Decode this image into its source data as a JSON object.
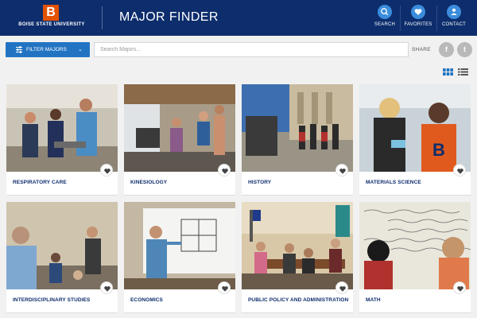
{
  "header": {
    "logo_letter": "B",
    "logo_text": "BOISE STATE UNIVERSITY",
    "title": "MAJOR FINDER",
    "search_label": "SEARCH",
    "favorites_label": "FAVORITES",
    "contact_label": "CONTACT"
  },
  "toolbar": {
    "filter_label": "FILTER MAJORS",
    "search_placeholder": "Search Majors...",
    "share_label": "SHARE",
    "facebook_glyph": "f",
    "twitter_glyph": "t"
  },
  "majors": [
    {
      "name": "RESPIRATORY CARE"
    },
    {
      "name": "KINESIOLOGY"
    },
    {
      "name": "HISTORY"
    },
    {
      "name": "MATERIALS SCIENCE"
    },
    {
      "name": "INTERDISCIPLINARY STUDIES"
    },
    {
      "name": "ECONOMICS"
    },
    {
      "name": "PUBLIC POLICY AND ADMINISTRATION"
    },
    {
      "name": "MATH"
    }
  ],
  "colors": {
    "brand_blue": "#0d2d6c",
    "accent_blue": "#2274c3",
    "brand_orange": "#e35205"
  }
}
